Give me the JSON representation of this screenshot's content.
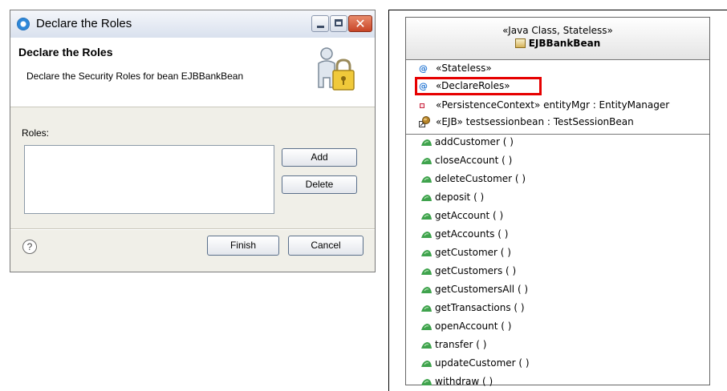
{
  "dialog": {
    "title": "Declare the Roles",
    "header_title": "Declare the Roles",
    "header_description": "Declare the Security Roles for bean EJBBankBean",
    "roles_label": "Roles:",
    "add_label": "Add",
    "delete_label": "Delete",
    "help_glyph": "?",
    "finish_label": "Finish",
    "cancel_label": "Cancel",
    "close_glyph": "✕",
    "icons": {
      "app": "eclipse-icon",
      "banner": "user-lock-icon",
      "help": "help-icon"
    },
    "colors": {
      "titlebar": "#d9e1ee",
      "close_button": "#c84527"
    }
  },
  "uml": {
    "stereotype": "«Java Class, Stateless»",
    "class_name": "EJBBankBean",
    "attributes": [
      {
        "icon": "annotation-icon",
        "text": "«Stateless»"
      },
      {
        "icon": "annotation-icon",
        "text": "«DeclareRoles»",
        "highlighted": true
      },
      {
        "icon": "field-icon",
        "text": "«PersistenceContext» entityMgr : EntityManager"
      },
      {
        "icon": "ejb-reference-icon",
        "text": "«EJB» testsessionbean : TestSessionBean"
      }
    ],
    "methods": [
      "addCustomer ( )",
      "closeAccount ( )",
      "deleteCustomer ( )",
      "deposit ( )",
      "getAccount ( )",
      "getAccounts ( )",
      "getCustomer ( )",
      "getCustomers ( )",
      "getCustomersAll ( )",
      "getTransactions ( )",
      "openAccount ( )",
      "transfer ( )",
      "updateCustomer ( )",
      "withdraw ( )"
    ],
    "annotation_glyph": "@",
    "colors": {
      "highlight": "#e60000",
      "annotation": "#2a7ad4",
      "method_icon": "#3fa34d"
    }
  }
}
